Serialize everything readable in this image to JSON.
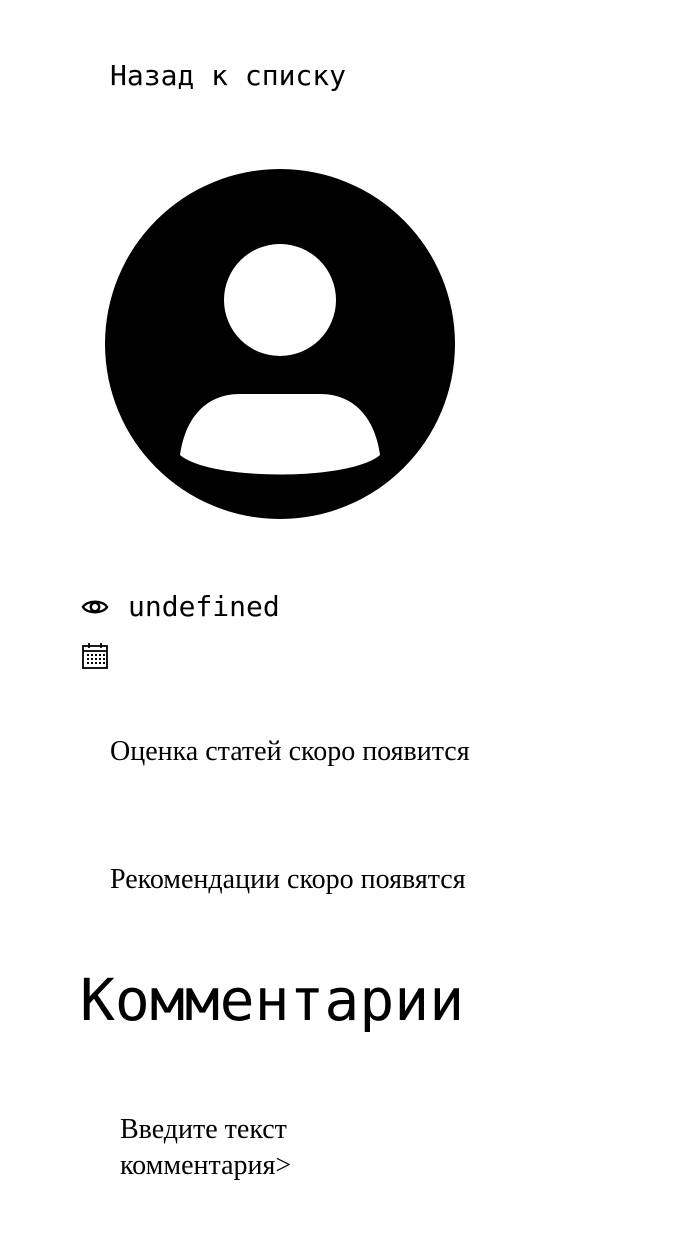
{
  "nav": {
    "back_label": "Назад к списку"
  },
  "article": {
    "avatar_icon": "user-avatar-icon",
    "views_icon": "eye-icon",
    "views_value": "undefined",
    "date_icon": "calendar-icon",
    "date_value": ""
  },
  "rating": {
    "notice": "Оценка статей скоро появится"
  },
  "recommendations": {
    "notice": "Рекомендации скоро появятся"
  },
  "comments": {
    "title": "Комментарии",
    "input_placeholder": "Введите текст комментария>"
  }
}
